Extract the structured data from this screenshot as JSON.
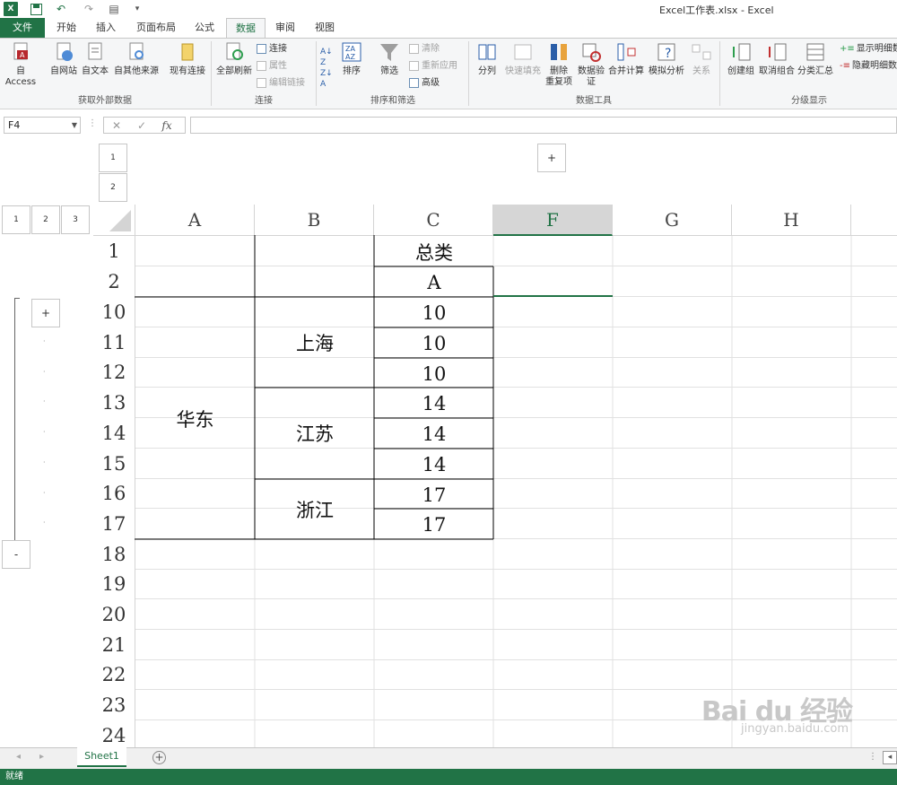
{
  "app": {
    "title": "Excel工作表.xlsx - Excel"
  },
  "tabs": [
    {
      "label": "文件"
    },
    {
      "label": "开始"
    },
    {
      "label": "插入"
    },
    {
      "label": "页面布局"
    },
    {
      "label": "公式"
    },
    {
      "label": "数据"
    },
    {
      "label": "审阅"
    },
    {
      "label": "视图"
    }
  ],
  "ribbon": {
    "external": {
      "access": "自 Access",
      "web": "自网站",
      "text": "自文本",
      "other": "自其他来源",
      "existing": "现有连接",
      "group": "获取外部数据"
    },
    "connections": {
      "refresh": "全部刷新",
      "conn": "连接",
      "props": "属性",
      "edit": "编辑链接",
      "group": "连接"
    },
    "sort": {
      "sort": "排序",
      "filter": "筛选",
      "clear": "清除",
      "reapply": "重新应用",
      "advanced": "高级",
      "group": "排序和筛选"
    },
    "tools": {
      "split": "分列",
      "flash": "快速填充",
      "dup1": "删除",
      "dup2": "重复项",
      "valid1": "数据验",
      "valid2": "证",
      "consolidate": "合并计算",
      "whatif": "模拟分析",
      "relations": "关系",
      "group": "数据工具"
    },
    "outline": {
      "group_btn": "创建组",
      "ungroup": "取消组合",
      "subtotal": "分类汇总",
      "show": "显示明细数",
      "hide": "隐藏明细数",
      "group": "分级显示"
    }
  },
  "formula_bar": {
    "namebox": "F4",
    "fx": "fx",
    "x": "✕",
    "check": "✓",
    "value": ""
  },
  "outline": {
    "col_levels": [
      "1",
      "2"
    ],
    "row_levels": [
      "1",
      "2",
      "3"
    ],
    "plus": "+",
    "minus": "-"
  },
  "columns": [
    "A",
    "B",
    "C",
    "F",
    "G",
    "H"
  ],
  "rows": [
    "1",
    "2",
    "10",
    "11",
    "12",
    "13",
    "14",
    "15",
    "16",
    "17",
    "18",
    "19",
    "20",
    "21",
    "22",
    "23",
    "24"
  ],
  "cells": {
    "c1": "总类",
    "c2": "A",
    "a_region": "华东",
    "b_shanghai": "上海",
    "b_jiangsu": "江苏",
    "b_zhejiang": "浙江",
    "c_values": [
      "10",
      "10",
      "10",
      "14",
      "14",
      "14",
      "17",
      "17"
    ]
  },
  "sheet_tabs": [
    {
      "label": "Sheet1"
    }
  ],
  "status": {
    "text": "就绪"
  },
  "watermark": {
    "brand": "Bai du 经验",
    "url": "jingyan.baidu.com"
  }
}
